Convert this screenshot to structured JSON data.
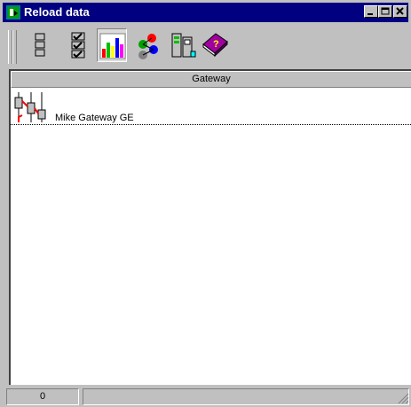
{
  "window": {
    "title": "Reload data",
    "icon": "app-icon",
    "controls": [
      "minimize-icon",
      "maximize-icon",
      "close-icon"
    ]
  },
  "toolbar": {
    "buttons": [
      {
        "name": "list-view-button",
        "icon": "stacked-boxes-icon",
        "pressed": false
      },
      {
        "name": "checklist-button",
        "icon": "checklist-icon",
        "pressed": false
      },
      {
        "name": "chart-button",
        "icon": "bar-chart-icon",
        "pressed": true
      },
      {
        "name": "network-button",
        "icon": "network-nodes-icon",
        "pressed": false
      },
      {
        "name": "device-button",
        "icon": "device-icon",
        "pressed": false
      },
      {
        "name": "help-book-button",
        "icon": "help-book-icon",
        "pressed": false
      }
    ]
  },
  "list": {
    "column_header": "Gateway",
    "rows": [
      {
        "label": "Mike Gateway GE",
        "icon": "gateway-icon"
      }
    ]
  },
  "statusbar": {
    "count": "0",
    "message": ""
  },
  "colors": {
    "titlebar": "#000080",
    "face": "#c0c0c0"
  }
}
